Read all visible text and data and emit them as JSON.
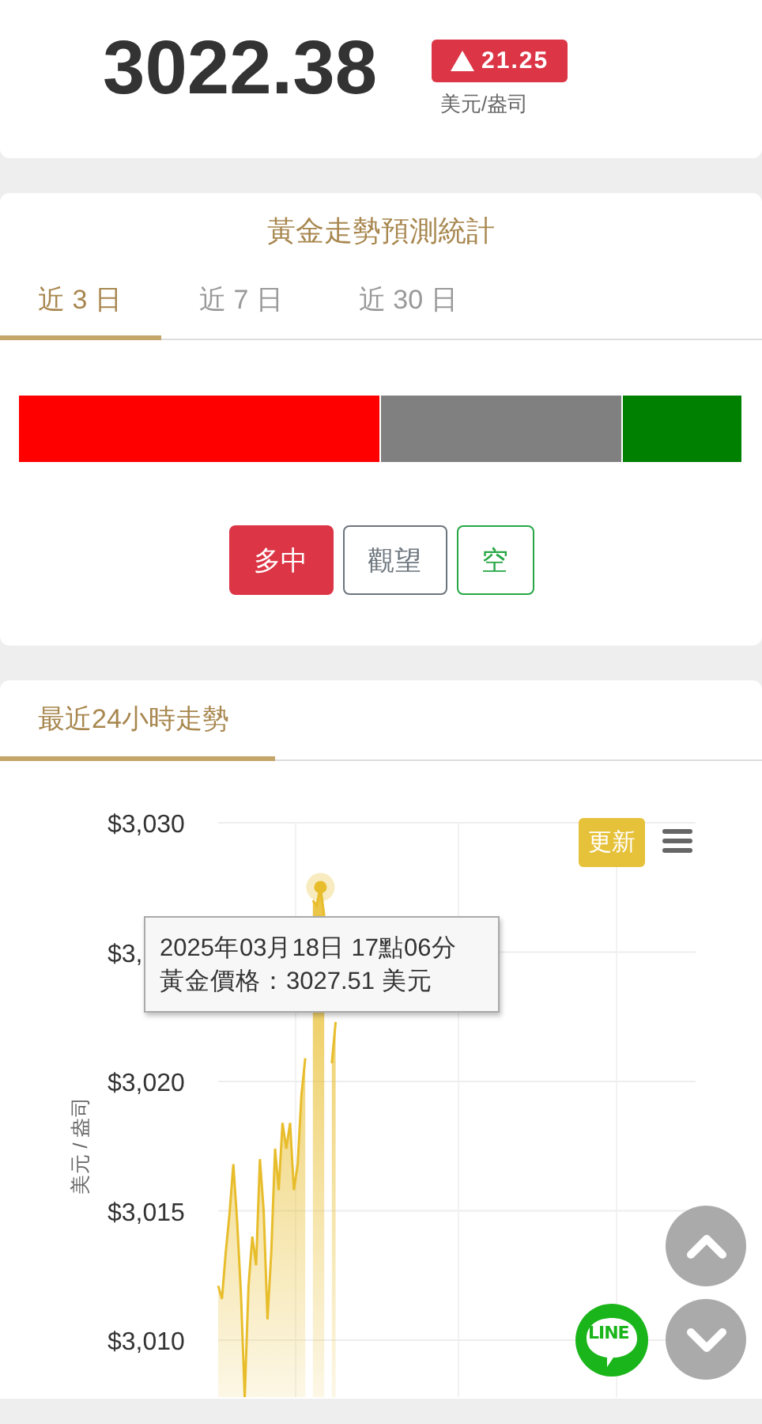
{
  "quote": {
    "price": "3022.38",
    "change": "21.25",
    "unit": "美元/盎司"
  },
  "forecast": {
    "title": "黃金走勢預測統計",
    "tabs": [
      {
        "label": "近 3 日",
        "selected": true
      },
      {
        "label": "近 7 日",
        "selected": false
      },
      {
        "label": "近 30 日",
        "selected": false
      }
    ],
    "segments": [
      {
        "color": "#ff0000"
      },
      {
        "color": "#808080"
      },
      {
        "color": "#008000"
      }
    ],
    "buttons": [
      {
        "label": "多中",
        "selected": true,
        "color": "#dc3545"
      },
      {
        "label": "觀望",
        "selected": false,
        "color": "#6c757d"
      },
      {
        "label": "空",
        "selected": false,
        "color": "#28a745"
      }
    ]
  },
  "trend": {
    "tab": "最近24小時走勢",
    "update_button": "更新",
    "covered_tick_label": "$3,",
    "tooltip": {
      "time": "2025年03月18日 17點06分",
      "price": "黃金價格：3027.51 美元"
    },
    "chart_data": {
      "type": "area",
      "ylabel": "美元 / 盎司",
      "ylim": [
        3007.8,
        3030
      ],
      "grid": true,
      "yticks": [
        {
          "value": 3030,
          "label": "$3,030"
        },
        {
          "value": 3020,
          "label": "$3,020"
        },
        {
          "value": 3015,
          "label": "$3,015"
        },
        {
          "value": 3010,
          "label": "$3,010"
        }
      ],
      "categories": [
        null,
        null,
        null,
        null,
        null,
        null,
        null,
        null,
        null,
        null,
        null,
        null,
        null,
        null,
        null,
        null,
        null,
        null,
        null,
        null,
        null,
        null,
        null,
        null,
        null,
        null,
        null,
        null,
        null,
        null,
        null,
        null,
        null,
        null,
        null,
        null,
        null,
        null,
        null,
        null,
        null,
        null,
        null,
        null,
        null,
        null,
        null,
        null,
        null,
        null,
        null,
        null,
        null,
        null,
        null,
        null,
        null,
        null,
        null,
        null,
        null,
        null,
        null,
        null,
        null,
        null,
        null,
        null,
        null,
        null,
        null,
        null,
        null,
        null,
        null,
        null,
        null,
        null,
        null,
        null,
        null,
        null,
        null,
        null,
        null,
        null,
        null,
        null,
        null,
        null,
        null,
        null,
        null,
        null,
        null,
        null,
        null,
        null,
        null,
        null,
        null,
        null,
        null,
        null,
        null,
        null,
        null,
        null,
        null,
        null,
        null,
        null,
        null,
        null,
        null,
        null,
        null,
        null,
        null,
        null,
        null,
        null,
        null,
        null,
        null,
        null,
        null
      ],
      "series": [
        {
          "color": "#e8bd2c",
          "values": [
            3012.1,
            3011.6,
            3013.4,
            3014.9,
            3016.8,
            3014.6,
            3011.8,
            3007.8,
            3012.1,
            3014.0,
            3012.9,
            3017.0,
            3015.0,
            3010.8,
            3013.4,
            3017.4,
            3015.8,
            3018.4,
            3017.4,
            3018.4,
            3015.8,
            3016.8,
            3019.5,
            3020.9,
            null,
            3027.0,
            3026.8,
            3027.51,
            3026.4,
            null,
            3020.7,
            3022.3,
            null,
            null,
            null,
            null,
            null,
            null,
            null,
            null,
            null,
            null,
            null,
            null,
            null,
            null,
            null,
            null,
            null,
            null,
            null,
            null,
            null,
            null,
            null,
            null,
            null,
            null,
            null,
            null,
            null,
            null,
            null,
            null,
            null,
            null,
            null,
            null,
            null,
            null,
            null,
            null,
            null,
            null,
            null,
            null,
            null,
            null,
            null,
            null,
            null,
            null,
            null,
            null,
            null,
            null,
            null,
            null,
            null,
            null,
            null,
            null,
            null,
            null,
            null,
            null,
            null,
            null,
            null,
            null,
            null,
            null,
            null,
            null,
            null,
            null,
            null,
            null,
            null,
            null,
            null,
            null,
            null,
            null,
            null,
            null,
            null,
            null,
            null,
            null,
            null,
            null,
            null,
            null,
            null,
            null,
            null
          ]
        }
      ]
    },
    "line_button": "LINE"
  }
}
